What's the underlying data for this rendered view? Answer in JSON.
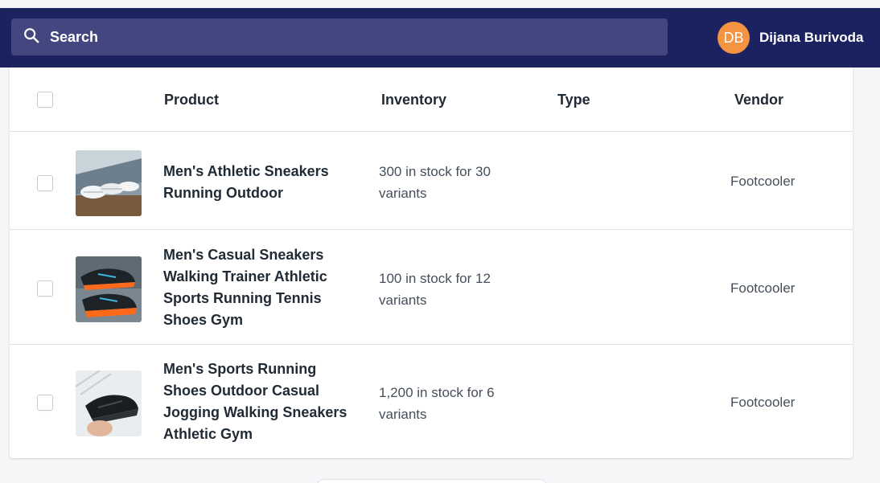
{
  "search": {
    "placeholder": "Search"
  },
  "user": {
    "initials": "DB",
    "name": "Dijana Burivoda"
  },
  "table": {
    "headers": {
      "product": "Product",
      "inventory": "Inventory",
      "type": "Type",
      "vendor": "Vendor"
    },
    "rows": [
      {
        "name": "Men's Athletic Sneakers Running Outdoor",
        "inventory": "300 in stock for 30 variants",
        "type": "",
        "vendor": "Footcooler",
        "image": "white-sneakers-photo"
      },
      {
        "name": "Men's Casual Sneakers Walking Trainer Athletic Sports Running Tennis Shoes Gym",
        "inventory": "100 in stock for 12 variants",
        "type": "",
        "vendor": "Footcooler",
        "image": "black-orange-sneakers-photo"
      },
      {
        "name": "Men's Sports Running Shoes Outdoor Casual Jogging Walking Sneakers Athletic Gym",
        "inventory": "1,200 in stock for 6 variants",
        "type": "",
        "vendor": "Footcooler",
        "image": "black-sneaker-in-hand-photo"
      }
    ]
  },
  "colors": {
    "topbar": "#1c2260",
    "search_bg": "#43467f",
    "avatar": "#f49342"
  }
}
